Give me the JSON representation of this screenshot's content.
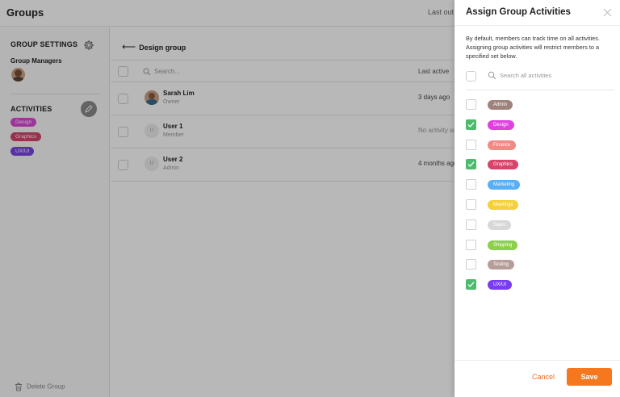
{
  "app": {
    "title": "Groups",
    "last_out": "Last out"
  },
  "sidebar": {
    "group_settings": "GROUP SETTINGS",
    "group_managers": "Group Managers",
    "activities_heading": "ACTIVITIES",
    "activities": [
      {
        "label": "Design",
        "color": "#d94ad6"
      },
      {
        "label": "Graphics",
        "color": "#d0476c"
      },
      {
        "label": "UX/UI",
        "color": "#7a45e8"
      }
    ],
    "delete_group": "Delete Group"
  },
  "main": {
    "back_label": "Design group",
    "search_placeholder": "Search...",
    "col_last_active": "Last active",
    "members": [
      {
        "name": "Sarah Lim",
        "role": "Owner",
        "last_active": "3 days ago",
        "avatar_letter": ""
      },
      {
        "name": "User 1",
        "role": "Member",
        "last_active": "No activity so",
        "avatar_letter": "U"
      },
      {
        "name": "User 2",
        "role": "Admin",
        "last_active": "4 months ago",
        "avatar_letter": "U"
      }
    ]
  },
  "drawer": {
    "title": "Assign Group Activities",
    "description": "By default, members can track time on all activities. Assigning group activities will restrict members to a specified set below.",
    "search_placeholder": "Search all activities",
    "activities": [
      {
        "label": "Admin",
        "color": "#a0827d",
        "checked": false
      },
      {
        "label": "Design",
        "color": "#e040e0",
        "checked": true
      },
      {
        "label": "Finance",
        "color": "#f08a84",
        "checked": false
      },
      {
        "label": "Graphics",
        "color": "#d8446a",
        "checked": true
      },
      {
        "label": "Marketing",
        "color": "#5aaef2",
        "checked": false
      },
      {
        "label": "Meetings",
        "color": "#f4d13a",
        "checked": false
      },
      {
        "label": "Sales",
        "color": "#d8d8d8",
        "checked": false
      },
      {
        "label": "Shipping",
        "color": "#8ccf4d",
        "checked": false
      },
      {
        "label": "Testing",
        "color": "#b79d98",
        "checked": false
      },
      {
        "label": "UX/UI",
        "color": "#7a3cf0",
        "checked": true
      }
    ],
    "cancel_label": "Cancel",
    "save_label": "Save"
  }
}
